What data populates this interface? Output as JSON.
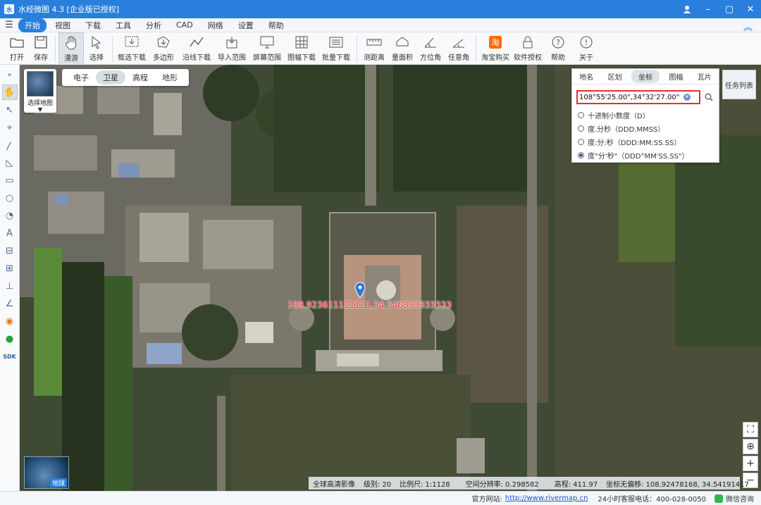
{
  "window": {
    "title": "水经微图 4.3 [企业版已授权]",
    "app_icon": "水"
  },
  "menubar": {
    "items": [
      {
        "label": "开始",
        "active": true
      },
      {
        "label": "视图"
      },
      {
        "label": "下载"
      },
      {
        "label": "工具"
      },
      {
        "label": "分析"
      },
      {
        "label": "CAD"
      },
      {
        "label": "网络"
      },
      {
        "label": "设置"
      },
      {
        "label": "帮助"
      }
    ]
  },
  "toolbar": {
    "open": "打开",
    "save": "保存",
    "pan": "漫游",
    "select": "选择",
    "box_download": "框选下载",
    "polygon": "多边形",
    "line_download": "沿线下载",
    "import_range": "导入范围",
    "screen_range": "屏幕范围",
    "sheet_download": "图幅下载",
    "batch_download": "批量下载",
    "measure_distance": "测距离",
    "measure_area": "量面积",
    "azimuth": "方位角",
    "any_angle": "任意角",
    "taobao_buy": "淘宝购买",
    "license": "软件授权",
    "help": "帮助",
    "about": "关于",
    "taobao_glyph": "淘"
  },
  "map_type": {
    "options": [
      "电子",
      "卫星",
      "高程",
      "地形"
    ],
    "selected": "卫星"
  },
  "basemap": {
    "label": "选择地图"
  },
  "marker": {
    "label": "108.923611111111,34.540833333333"
  },
  "search_panel": {
    "tabs": [
      "地名",
      "区划",
      "坐标",
      "图幅",
      "瓦片"
    ],
    "active_tab": "坐标",
    "input_value": "108°55'25.00\",34°32'27.00\"",
    "options": [
      {
        "label": "十进制小数度（D）",
        "checked": false
      },
      {
        "label": "度.分秒（DDD.MMSS）",
        "checked": false
      },
      {
        "label": "度:分:秒（DDD:MM:SS.SS）",
        "checked": false
      },
      {
        "label": "度°分'秒\"（DDD°MM'SS.SS\"）",
        "checked": true
      }
    ]
  },
  "task_list": {
    "label": "任务列表"
  },
  "earth": {
    "label": "地球"
  },
  "status": {
    "imagery": "全球高清影像",
    "level_key": "级别:",
    "level": "20",
    "scale_key": "比例尺:",
    "scale": "1:1128",
    "resolution_key": "空间分辨率:",
    "resolution": "0.298582",
    "elevation_key": "高程:",
    "elevation": "411.97",
    "coord_key": "坐标无偏移:",
    "coord": "108.92478168, 34.54191417"
  },
  "footer": {
    "site_label": "官方网站:",
    "site_url": "http://www.rivermap.cn",
    "hotline": "24小时客服电话：400-028-0050",
    "wechat": "微信咨询"
  }
}
